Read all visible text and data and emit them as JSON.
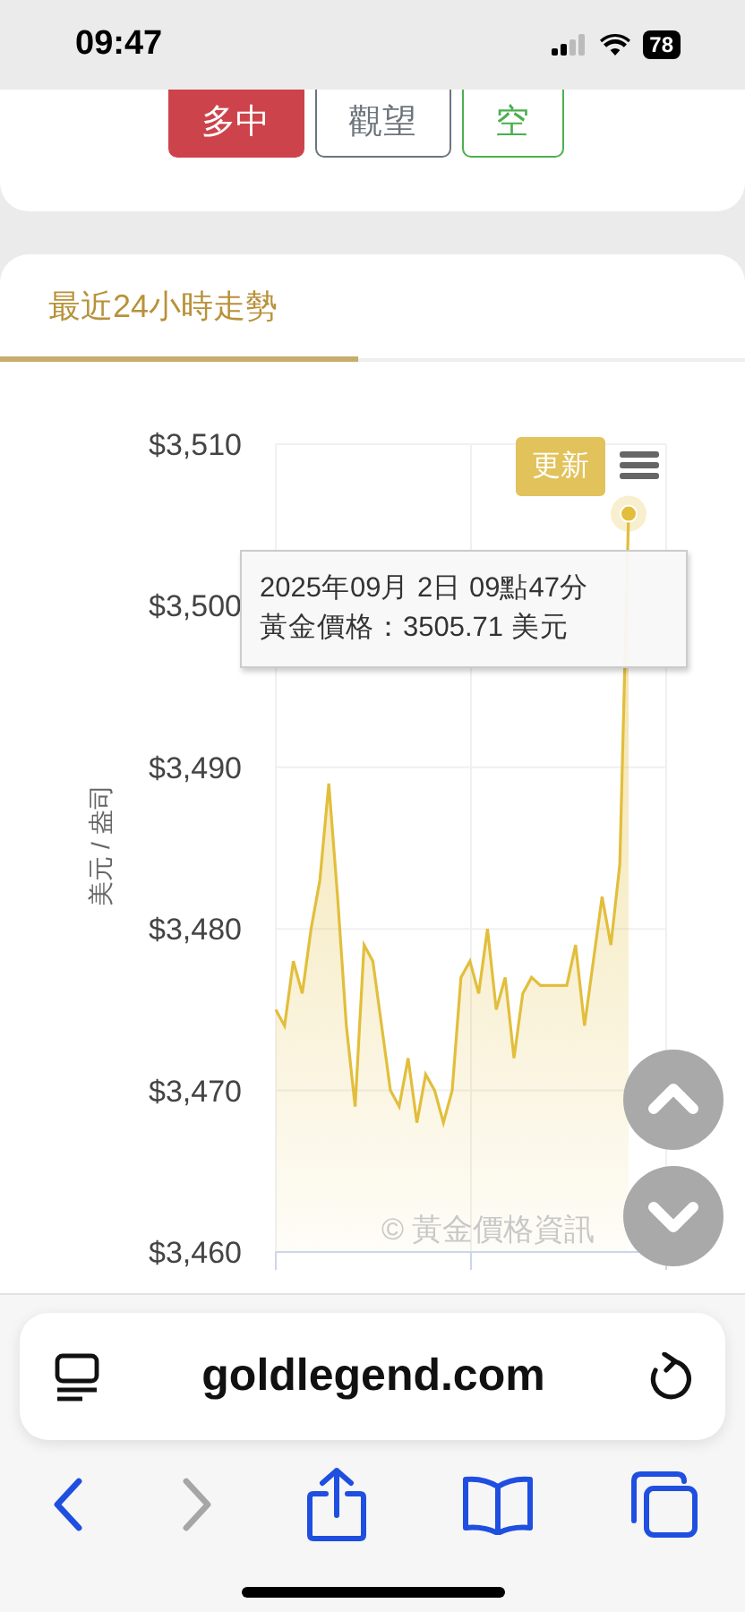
{
  "status_bar": {
    "time": "09:47",
    "battery": "78"
  },
  "signal_buttons": [
    {
      "label": "多中",
      "kind": "bull",
      "selected": true
    },
    {
      "label": "觀望",
      "kind": "neutral",
      "selected": false
    },
    {
      "label": "空",
      "kind": "bear",
      "selected": false
    }
  ],
  "tabs": [
    {
      "label": "最近24小時走勢",
      "selected": true
    }
  ],
  "chart": {
    "update_button": "更新",
    "tooltip": {
      "line_1": "2025年09月 2日 09點47分",
      "line_2": "黃金價格：3505.71 美元"
    },
    "credit": "© 黃金價格資訊",
    "chart_data": {
      "type": "area",
      "grid": true,
      "ylabel": "美元 / 盎司",
      "ylim": [
        3460,
        3510
      ],
      "yticks": [
        {
          "value": 3460,
          "label": "$3,460"
        },
        {
          "value": 3470,
          "label": "$3,470"
        },
        {
          "value": 3480,
          "label": "$3,480"
        },
        {
          "value": 3490,
          "label": "$3,490"
        },
        {
          "value": 3500,
          "label": "$3,500"
        },
        {
          "value": 3510,
          "label": "$3,510"
        }
      ],
      "series": [
        {
          "color": "#e2be3c",
          "values": [
            3475,
            3474,
            3478,
            3476,
            3480,
            3483,
            3489,
            3482,
            3474,
            3469,
            3479,
            3478,
            3474,
            3470,
            3469,
            3472,
            3468,
            3471,
            3470,
            3468,
            3470,
            3477,
            3478,
            3476,
            3480,
            3475,
            3477,
            3472,
            3476,
            3477,
            3476.5,
            3476.5,
            3476.5,
            3476.5,
            3479,
            3474,
            3478,
            3482,
            3479,
            3484,
            3505.7
          ]
        }
      ]
    }
  },
  "browser": {
    "url": "goldlegend.com"
  }
}
